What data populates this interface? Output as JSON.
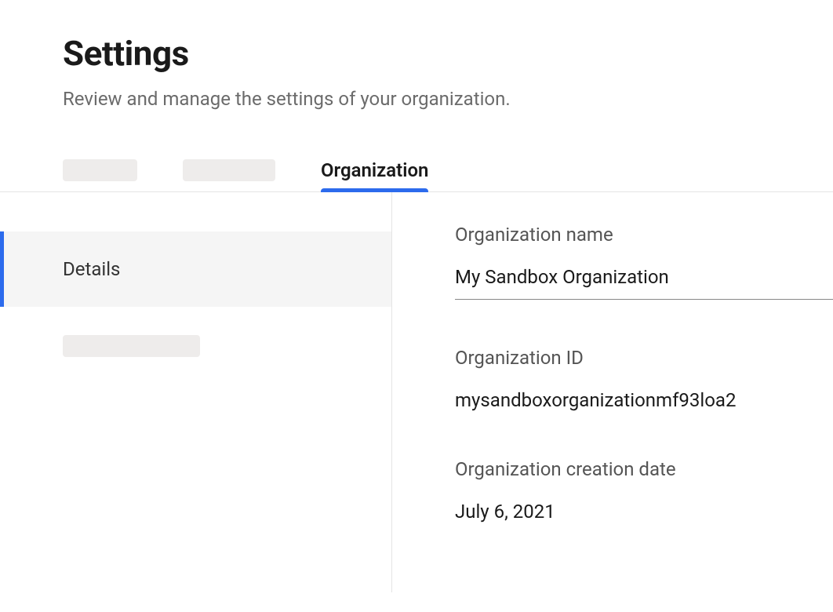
{
  "header": {
    "title": "Settings",
    "subtitle": "Review and manage the settings of your organization."
  },
  "tabs": {
    "active_label": "Organization"
  },
  "sidebar": {
    "items": [
      {
        "label": "Details"
      }
    ]
  },
  "main": {
    "org_name": {
      "label": "Organization name",
      "value": "My Sandbox Organization"
    },
    "org_id": {
      "label": "Organization ID",
      "value": "mysandboxorganizationmf93loa2"
    },
    "org_creation_date": {
      "label": "Organization creation date",
      "value": "July 6, 2021"
    }
  }
}
